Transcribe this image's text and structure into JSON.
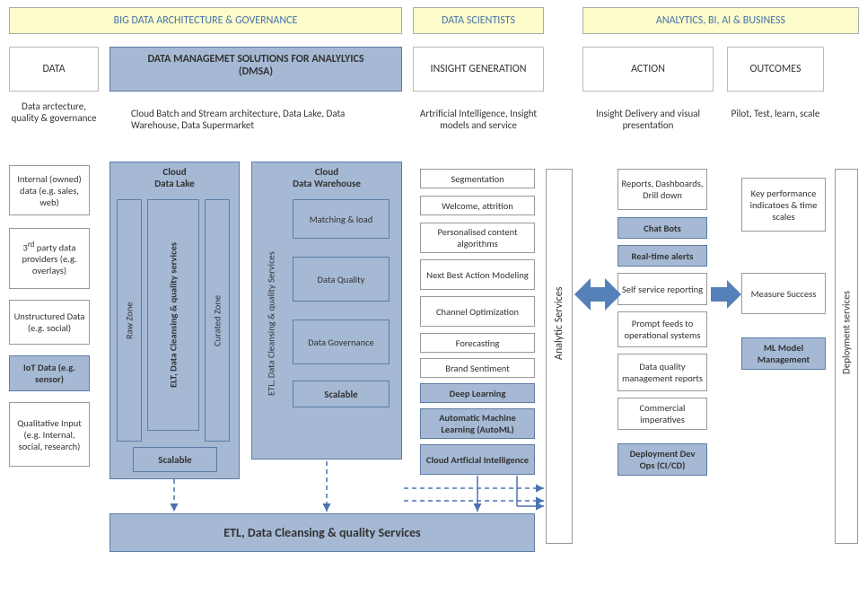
{
  "headers": {
    "big_data": "BIG DATA ARCHITECTURE & GOVERNANCE",
    "scientists": "DATA SCIENTISTS",
    "analytics": "ANALYTICS, BI, AI & BUSINESS"
  },
  "cols": {
    "data": {
      "title": "DATA",
      "sub": "Data arctecture, quality & governance"
    },
    "dmsa": {
      "title": "DATA MANAGEMET SOLUTIONS FOR ANALYLYICS",
      "title2": "(DMSA)",
      "sub": "Cloud Batch and Stream architecture, Data Lake, Data Warehouse, Data Supermarket"
    },
    "insight": {
      "title": "INSIGHT GENERATION",
      "sub": "Artrificial Intelligence, Insight models and service"
    },
    "action": {
      "title": "ACTION",
      "sub": "Insight Delivery and visual presentation"
    },
    "outcomes": {
      "title": "OUTCOMES",
      "sub": "Pilot, Test, learn, scale"
    }
  },
  "data_sources": {
    "internal": "Internal (owned) data (e.g. sales, web)",
    "third_party": "3rd party data providers (e.g. overlays)",
    "unstructured": "Unstructured Data (e.g. social)",
    "iot": "IoT Data (e.g. sensor)",
    "qualitative": "Qualitative Input (e.g. Internal, social, research)"
  },
  "lake": {
    "title": "Cloud Data Lake",
    "raw": "Raw Zone",
    "elt": "ELT, Data Cleansing & quality services",
    "curated": "Curated Zone",
    "scalable": "Scalable"
  },
  "warehouse": {
    "title": "Cloud Data Warehouse",
    "etl": "ETL, Data Cleansing & quality Services",
    "matching": "Matching & load",
    "quality": "Data Quality",
    "governance": "Data Governance",
    "scalable": "Scalable"
  },
  "insight_boxes": {
    "seg": "Segmentation",
    "welcome": "Welcome, attrition",
    "personalised": "Personalised content algorithms",
    "nba": "Next Best Action Modeling",
    "channel": "Channel Optimization",
    "forecast": "Forecasting",
    "brand": "Brand Sentiment",
    "deep": "Deep Learning",
    "automl": "Automatic Machine Learning (AutoML)",
    "cloud_ai": "Cloud Artficial Intelligence"
  },
  "analytic_services": "Analytic Services",
  "action_boxes": {
    "reports": "Reports, Dashboards, Drill down",
    "chatbots": "Chat Bots",
    "realtime": "Real-time alerts",
    "selfservice": "Self service reporting",
    "feeds": "Prompt feeds to operational systems",
    "dataqual": "Data quality management reports",
    "commercial": "Commercial imperatives",
    "devops": "Deployment Dev Ops (CI/CD)"
  },
  "outcome_boxes": {
    "kpi": "Key performance indicatoes & time scales",
    "measure": "Measure Success",
    "mlmodel": "ML Model Management"
  },
  "deployment": "Deployment services",
  "etl_bar": "ETL, Data Cleansing & quality Services"
}
